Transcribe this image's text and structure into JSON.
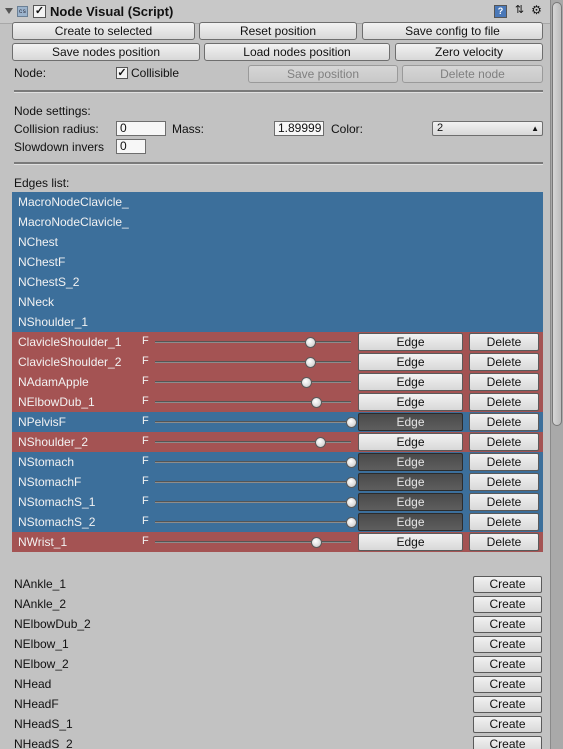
{
  "header": {
    "title": "Node Visual (Script)",
    "enabled": "✓",
    "icons": [
      "script-icon",
      "help-book-icon",
      "presets-icon",
      "gear-icon"
    ]
  },
  "buttons": {
    "create_to_selected": "Create to selected",
    "reset_position": "Reset position",
    "save_config": "Save config to file",
    "save_nodes_position": "Save nodes position",
    "load_nodes_position": "Load nodes position",
    "zero_velocity": "Zero velocity",
    "save_position": "Save position",
    "delete_node": "Delete node"
  },
  "node": {
    "label": "Node:",
    "collisible_label": "Collisible",
    "collisible_checked": "✓"
  },
  "settings": {
    "heading": "Node settings:",
    "collision_radius_label": "Collision radius:",
    "collision_radius_value": "0",
    "mass_label": "Mass:",
    "mass_value": "1.89999",
    "color_label": "Color:",
    "color_value": "2",
    "slowdown_label": "Slowdown invers",
    "slowdown_value": "0"
  },
  "edges": {
    "heading": "Edges list:",
    "colors": {
      "blue": "#3c6f9b",
      "red": "#a45353"
    },
    "plain_rows": [
      "MacroNodeClavicle_",
      "MacroNodeClavicle_",
      "NChest",
      "NChestF",
      "NChestS_2",
      "NNeck",
      "NShoulder_1"
    ],
    "f_label": "F",
    "edge_label": "Edge",
    "delete_label": "Delete",
    "slider_rows": [
      {
        "name": "ClavicleShoulder_1",
        "color": "red",
        "slider": 0.79,
        "pressed": false
      },
      {
        "name": "ClavicleShoulder_2",
        "color": "red",
        "slider": 0.79,
        "pressed": false
      },
      {
        "name": "NAdamApple",
        "color": "red",
        "slider": 0.77,
        "pressed": false
      },
      {
        "name": "NElbowDub_1",
        "color": "red",
        "slider": 0.82,
        "pressed": false
      },
      {
        "name": "NPelvisF",
        "color": "blue",
        "slider": 1.0,
        "pressed": true
      },
      {
        "name": "NShoulder_2",
        "color": "red",
        "slider": 0.84,
        "pressed": false
      },
      {
        "name": "NStomach",
        "color": "blue",
        "slider": 1.0,
        "pressed": true
      },
      {
        "name": "NStomachF",
        "color": "blue",
        "slider": 1.0,
        "pressed": true
      },
      {
        "name": "NStomachS_1",
        "color": "blue",
        "slider": 1.0,
        "pressed": true
      },
      {
        "name": "NStomachS_2",
        "color": "blue",
        "slider": 1.0,
        "pressed": true
      },
      {
        "name": "NWrist_1",
        "color": "red",
        "slider": 0.82,
        "pressed": false
      }
    ]
  },
  "nodes": {
    "create_label": "Create",
    "items": [
      "NAnkle_1",
      "NAnkle_2",
      "NElbowDub_2",
      "NElbow_1",
      "NElbow_2",
      "NHead",
      "NHeadF",
      "NHeadS_1",
      "NHeadS_2"
    ]
  }
}
